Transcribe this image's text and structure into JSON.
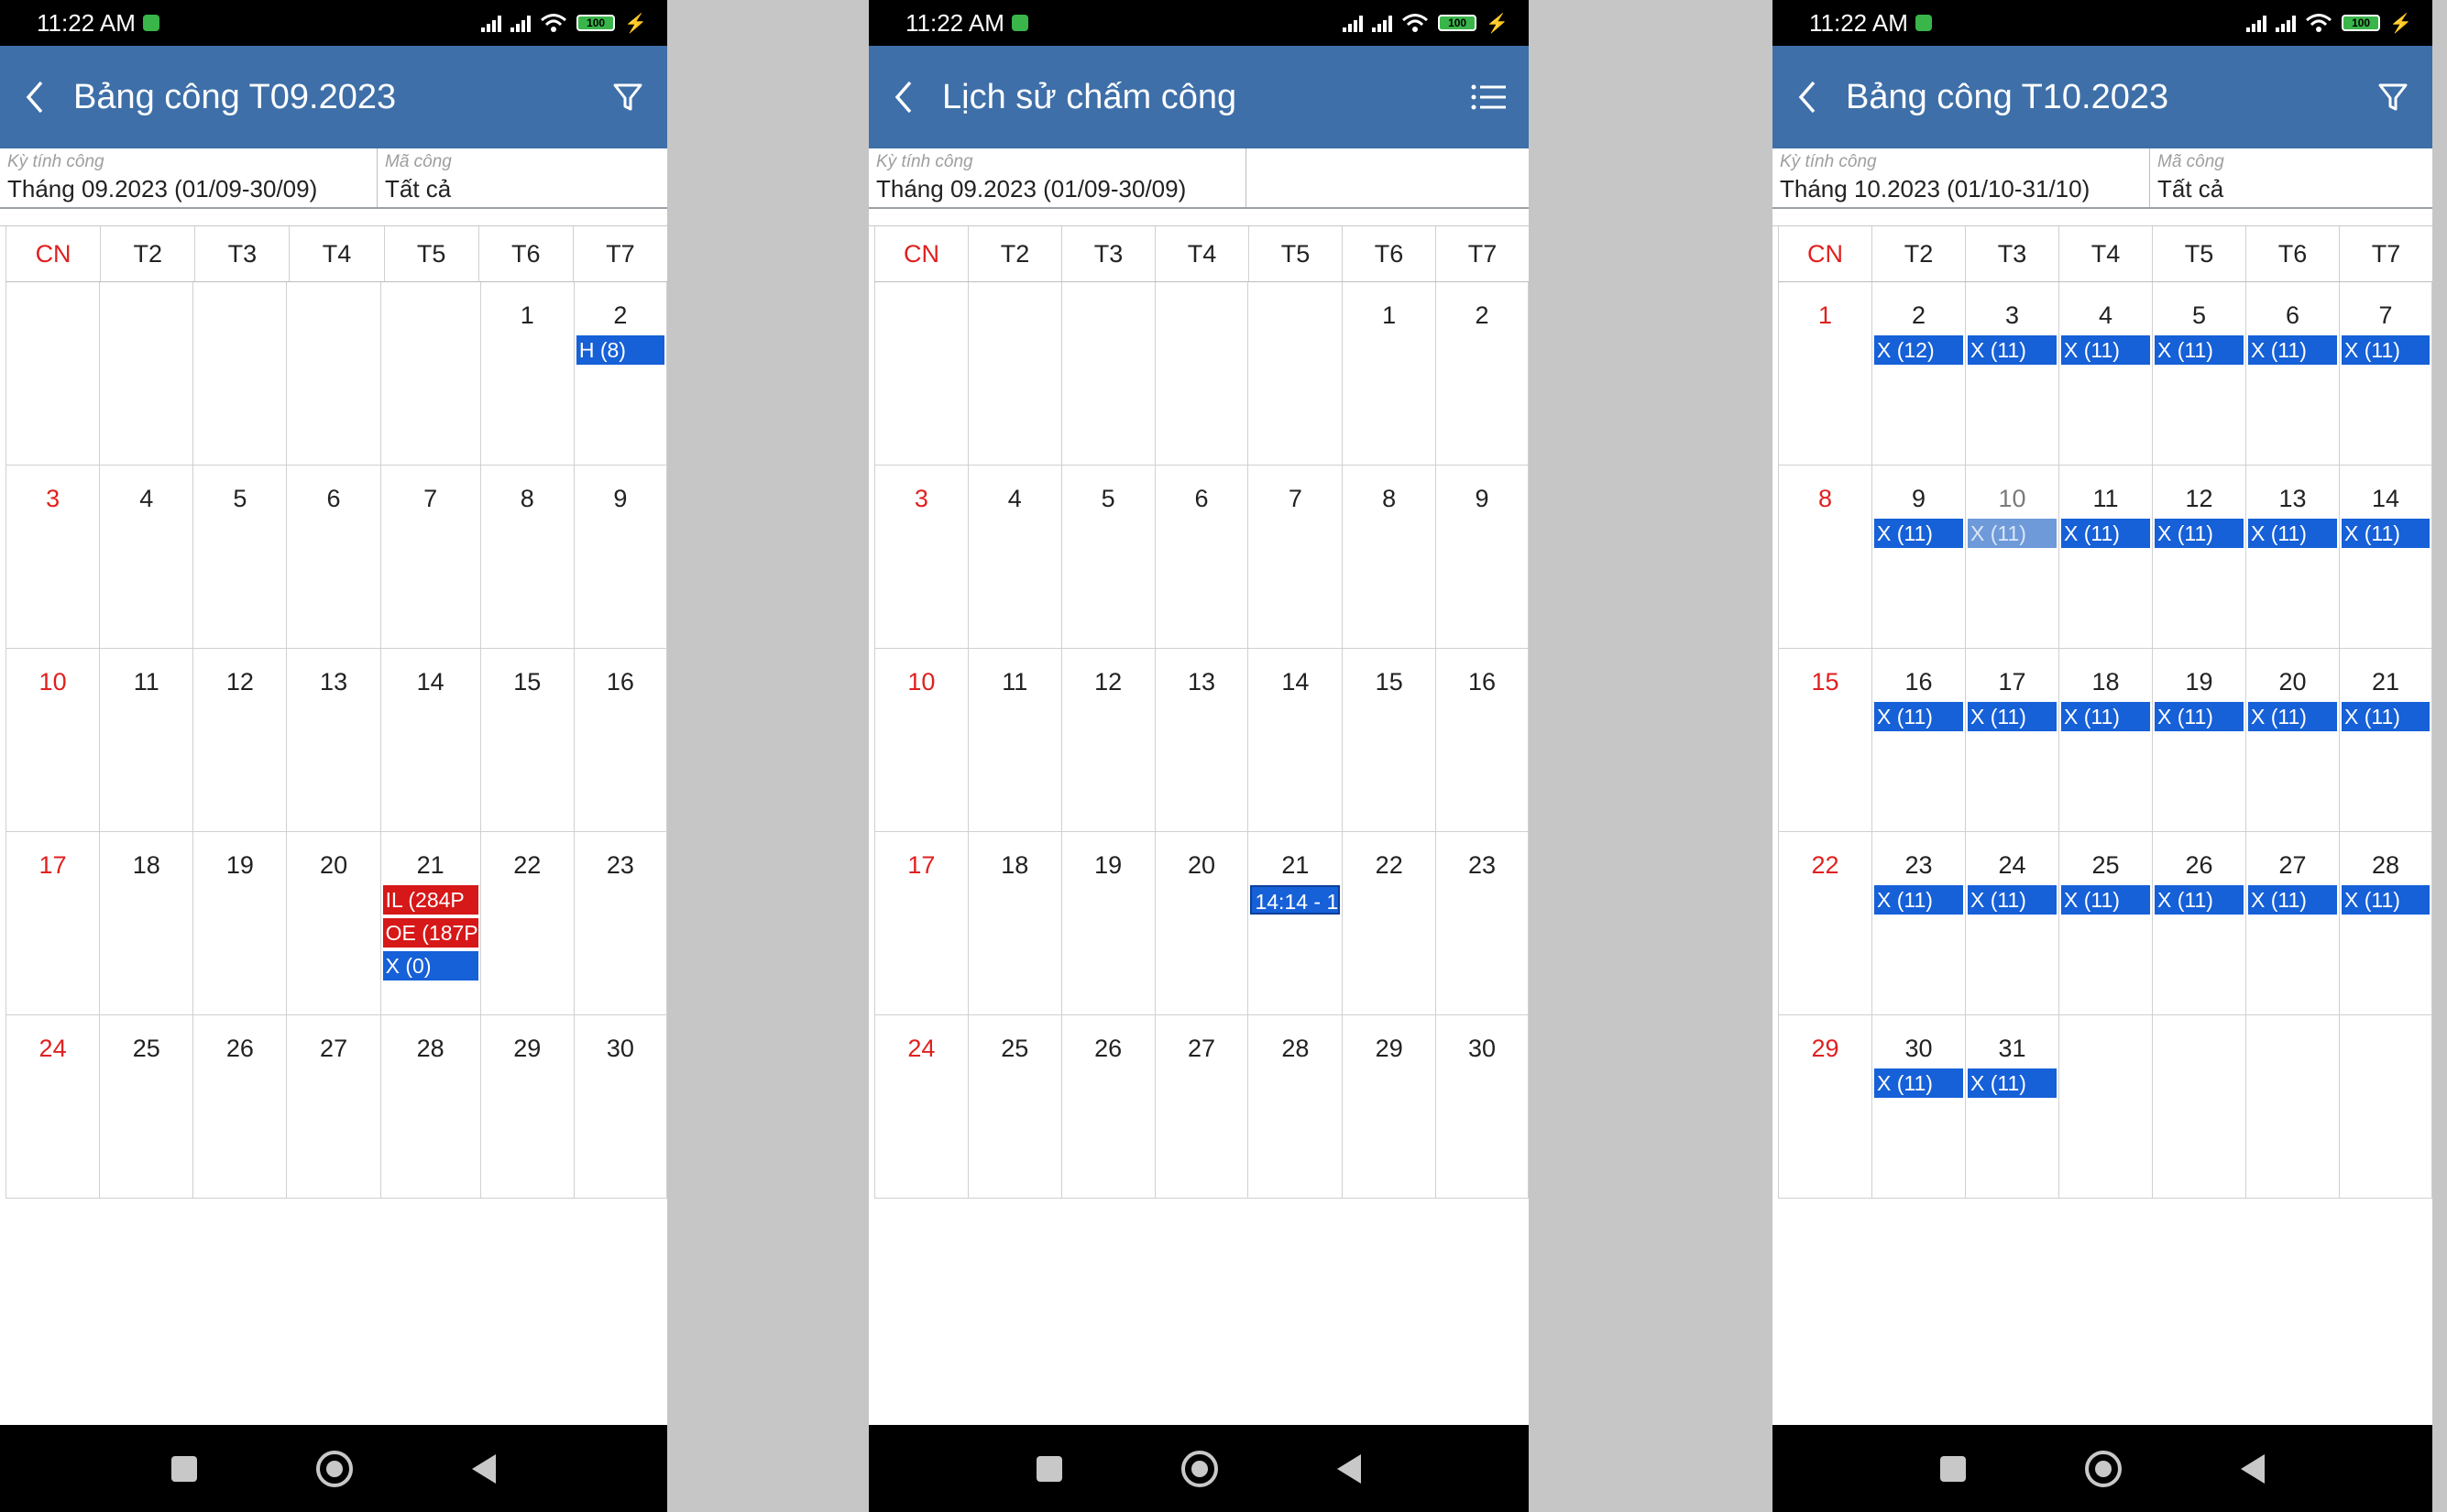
{
  "status_bar": {
    "time": "11:22 AM",
    "battery": "100"
  },
  "colors": {
    "appbar": "#3e6fa8",
    "event_blue": "#1660d8",
    "event_red": "#d61818",
    "sunday": "#e02020"
  },
  "weekdays": [
    "CN",
    "T2",
    "T3",
    "T4",
    "T5",
    "T6",
    "T7"
  ],
  "screens": [
    {
      "title": "Bảng công T09.2023",
      "action_icon": "filter-icon",
      "period_label": "Kỳ tính công",
      "period_value": "Tháng 09.2023 (01/09-30/09)",
      "code_label": "Mã công",
      "code_value": "Tất cả",
      "days": [
        {
          "d": ""
        },
        {
          "d": ""
        },
        {
          "d": ""
        },
        {
          "d": ""
        },
        {
          "d": ""
        },
        {
          "d": "1"
        },
        {
          "d": "2",
          "events": [
            {
              "t": "H (8)",
              "c": "blue"
            }
          ]
        },
        {
          "d": "3"
        },
        {
          "d": "4"
        },
        {
          "d": "5"
        },
        {
          "d": "6"
        },
        {
          "d": "7"
        },
        {
          "d": "8"
        },
        {
          "d": "9"
        },
        {
          "d": "10"
        },
        {
          "d": "11"
        },
        {
          "d": "12"
        },
        {
          "d": "13"
        },
        {
          "d": "14"
        },
        {
          "d": "15"
        },
        {
          "d": "16"
        },
        {
          "d": "17"
        },
        {
          "d": "18"
        },
        {
          "d": "19"
        },
        {
          "d": "20"
        },
        {
          "d": "21",
          "events": [
            {
              "t": "IL (284P",
              "c": "red"
            },
            {
              "t": "OE (187P",
              "c": "red"
            },
            {
              "t": "X (0)",
              "c": "blue"
            }
          ]
        },
        {
          "d": "22"
        },
        {
          "d": "23"
        },
        {
          "d": "24"
        },
        {
          "d": "25"
        },
        {
          "d": "26"
        },
        {
          "d": "27"
        },
        {
          "d": "28"
        },
        {
          "d": "29"
        },
        {
          "d": "30"
        }
      ]
    },
    {
      "title": "Lịch sử chấm công",
      "action_icon": "list-icon",
      "period_label": "Kỳ tính công",
      "period_value": "Tháng 09.2023 (01/09-30/09)",
      "code_label": "",
      "code_value": "",
      "days": [
        {
          "d": ""
        },
        {
          "d": ""
        },
        {
          "d": ""
        },
        {
          "d": ""
        },
        {
          "d": ""
        },
        {
          "d": "1"
        },
        {
          "d": "2"
        },
        {
          "d": "3"
        },
        {
          "d": "4"
        },
        {
          "d": "5"
        },
        {
          "d": "6"
        },
        {
          "d": "7"
        },
        {
          "d": "8"
        },
        {
          "d": "9"
        },
        {
          "d": "10"
        },
        {
          "d": "11"
        },
        {
          "d": "12"
        },
        {
          "d": "13"
        },
        {
          "d": "14"
        },
        {
          "d": "15"
        },
        {
          "d": "16"
        },
        {
          "d": "17"
        },
        {
          "d": "18"
        },
        {
          "d": "19"
        },
        {
          "d": "20"
        },
        {
          "d": "21",
          "events": [
            {
              "t": "14:14 - 1",
              "c": "blue-outline"
            }
          ]
        },
        {
          "d": "22"
        },
        {
          "d": "23"
        },
        {
          "d": "24"
        },
        {
          "d": "25"
        },
        {
          "d": "26"
        },
        {
          "d": "27"
        },
        {
          "d": "28"
        },
        {
          "d": "29"
        },
        {
          "d": "30"
        }
      ]
    },
    {
      "title": "Bảng công T10.2023",
      "action_icon": "filter-icon",
      "period_label": "Kỳ tính công",
      "period_value": "Tháng 10.2023 (01/10-31/10)",
      "code_label": "Mã công",
      "code_value": "Tất cả",
      "days": [
        {
          "d": "1"
        },
        {
          "d": "2",
          "events": [
            {
              "t": "X (12)",
              "c": "blue"
            }
          ]
        },
        {
          "d": "3",
          "events": [
            {
              "t": "X (11)",
              "c": "blue"
            }
          ]
        },
        {
          "d": "4",
          "events": [
            {
              "t": "X (11)",
              "c": "blue"
            }
          ]
        },
        {
          "d": "5",
          "events": [
            {
              "t": "X (11)",
              "c": "blue"
            }
          ]
        },
        {
          "d": "6",
          "events": [
            {
              "t": "X (11)",
              "c": "blue"
            }
          ]
        },
        {
          "d": "7",
          "events": [
            {
              "t": "X (11)",
              "c": "blue"
            }
          ]
        },
        {
          "d": "8"
        },
        {
          "d": "9",
          "events": [
            {
              "t": "X (11)",
              "c": "blue"
            }
          ]
        },
        {
          "d": "10",
          "faded": true,
          "events": [
            {
              "t": "X (11)",
              "c": "light"
            }
          ]
        },
        {
          "d": "11",
          "events": [
            {
              "t": "X (11)",
              "c": "blue"
            }
          ]
        },
        {
          "d": "12",
          "events": [
            {
              "t": "X (11)",
              "c": "blue"
            }
          ]
        },
        {
          "d": "13",
          "events": [
            {
              "t": "X (11)",
              "c": "blue"
            }
          ]
        },
        {
          "d": "14",
          "events": [
            {
              "t": "X (11)",
              "c": "blue"
            }
          ]
        },
        {
          "d": "15"
        },
        {
          "d": "16",
          "events": [
            {
              "t": "X (11)",
              "c": "blue"
            }
          ]
        },
        {
          "d": "17",
          "events": [
            {
              "t": "X (11)",
              "c": "blue"
            }
          ]
        },
        {
          "d": "18",
          "events": [
            {
              "t": "X (11)",
              "c": "blue"
            }
          ]
        },
        {
          "d": "19",
          "events": [
            {
              "t": "X (11)",
              "c": "blue"
            }
          ]
        },
        {
          "d": "20",
          "events": [
            {
              "t": "X (11)",
              "c": "blue"
            }
          ]
        },
        {
          "d": "21",
          "events": [
            {
              "t": "X (11)",
              "c": "blue"
            }
          ]
        },
        {
          "d": "22"
        },
        {
          "d": "23",
          "events": [
            {
              "t": "X (11)",
              "c": "blue"
            }
          ]
        },
        {
          "d": "24",
          "events": [
            {
              "t": "X (11)",
              "c": "blue"
            }
          ]
        },
        {
          "d": "25",
          "events": [
            {
              "t": "X (11)",
              "c": "blue"
            }
          ]
        },
        {
          "d": "26",
          "events": [
            {
              "t": "X (11)",
              "c": "blue"
            }
          ]
        },
        {
          "d": "27",
          "events": [
            {
              "t": "X (11)",
              "c": "blue"
            }
          ]
        },
        {
          "d": "28",
          "events": [
            {
              "t": "X (11)",
              "c": "blue"
            }
          ]
        },
        {
          "d": "29"
        },
        {
          "d": "30",
          "events": [
            {
              "t": "X (11)",
              "c": "blue"
            }
          ]
        },
        {
          "d": "31",
          "events": [
            {
              "t": "X (11)",
              "c": "blue"
            }
          ]
        },
        {
          "d": ""
        },
        {
          "d": ""
        },
        {
          "d": ""
        },
        {
          "d": ""
        }
      ]
    }
  ]
}
